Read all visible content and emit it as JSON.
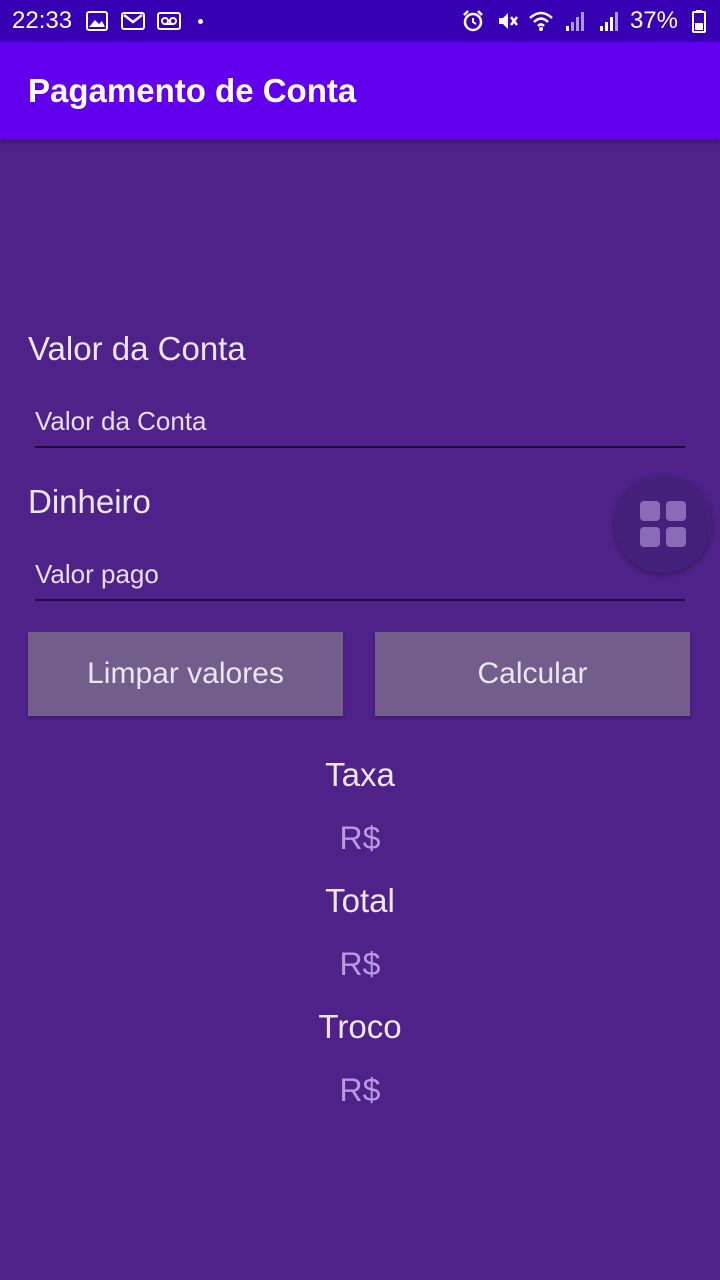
{
  "status_bar": {
    "time": "22:33",
    "battery": "37%",
    "left_icons": [
      "image-icon",
      "gmail-icon",
      "voicemail-icon",
      "dot-icon"
    ],
    "right_icons": [
      "alarm-icon",
      "mute-icon",
      "wifi-icon",
      "signal-icon",
      "signal-icon",
      "battery-icon"
    ]
  },
  "app_bar": {
    "title": "Pagamento de Conta"
  },
  "form": {
    "bill_label": "Valor da Conta",
    "bill_placeholder": "Valor da Conta",
    "cash_label": "Dinheiro",
    "cash_placeholder": "Valor pago"
  },
  "buttons": {
    "clear": "Limpar valores",
    "calculate": "Calcular"
  },
  "results": {
    "fee_label": "Taxa",
    "fee_value": "R$",
    "total_label": "Total",
    "total_value": "R$",
    "change_label": "Troco",
    "change_value": "R$"
  },
  "colors": {
    "status_bar": "#3700b3",
    "app_bar": "#6200ee",
    "background": "#4f2289",
    "button": "#725d8c",
    "value_text": "#b79ae0"
  }
}
